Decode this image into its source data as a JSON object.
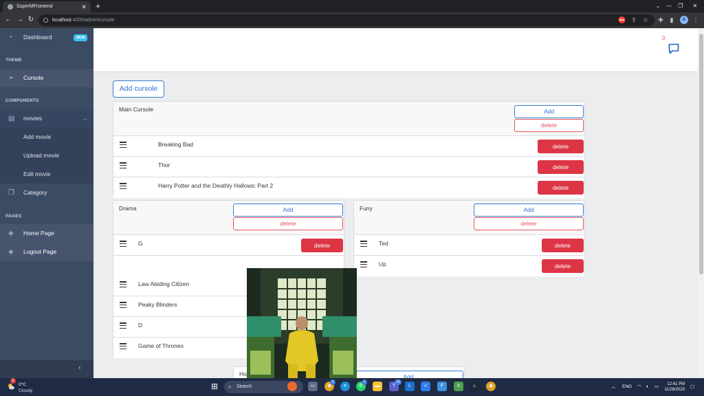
{
  "browser": {
    "tab_title": "SuperMFrontend",
    "url_host": "localhost",
    "url_path": ":4200/admin/cursole"
  },
  "sidebar": {
    "dashboard": {
      "label": "Dashboard",
      "badge": "NEW"
    },
    "section_theme": "THEME",
    "cursole": "Cursole",
    "section_components": "COMPONENTS",
    "movies": "movies",
    "add_movie": "Add movie",
    "upload_movie": "Upload movie",
    "edit_movie": "Edit movie",
    "category": "Category",
    "section_pages": "PAGES",
    "home_page": "Home Page",
    "logout_page": "Logout Page"
  },
  "header": {
    "message_count": "0"
  },
  "main": {
    "add_cursole_label": "Add cursole",
    "add_label": "Add",
    "delete_label": "delete",
    "cursoles": [
      {
        "title": "Main Cursole",
        "items": [
          "Breaking Bad",
          "Thor",
          "Harry Potter and the Deathly Hallows: Part 2"
        ]
      },
      {
        "title": "Drama",
        "items": [
          "G",
          "Law Abiding Citizen",
          "Peaky Blinders",
          "D",
          "Game of Thrones"
        ]
      },
      {
        "title": "Funy",
        "items": [
          "Ted",
          "Up"
        ]
      },
      {
        "title": "Ho"
      }
    ]
  },
  "taskbar": {
    "weather_temp": "0°C",
    "weather_desc": "Cloudy",
    "search_placeholder": "Search",
    "language": "ENG",
    "time": "12:41 PM",
    "date": "11/28/2023",
    "notif_weather": "1",
    "notif_chrome": "3",
    "notif_whatsapp": "1",
    "notif_teams": "23"
  },
  "colors": {
    "sidebar": "#3c4b64",
    "primary": "#3a7bd5",
    "danger": "#dc3545"
  }
}
